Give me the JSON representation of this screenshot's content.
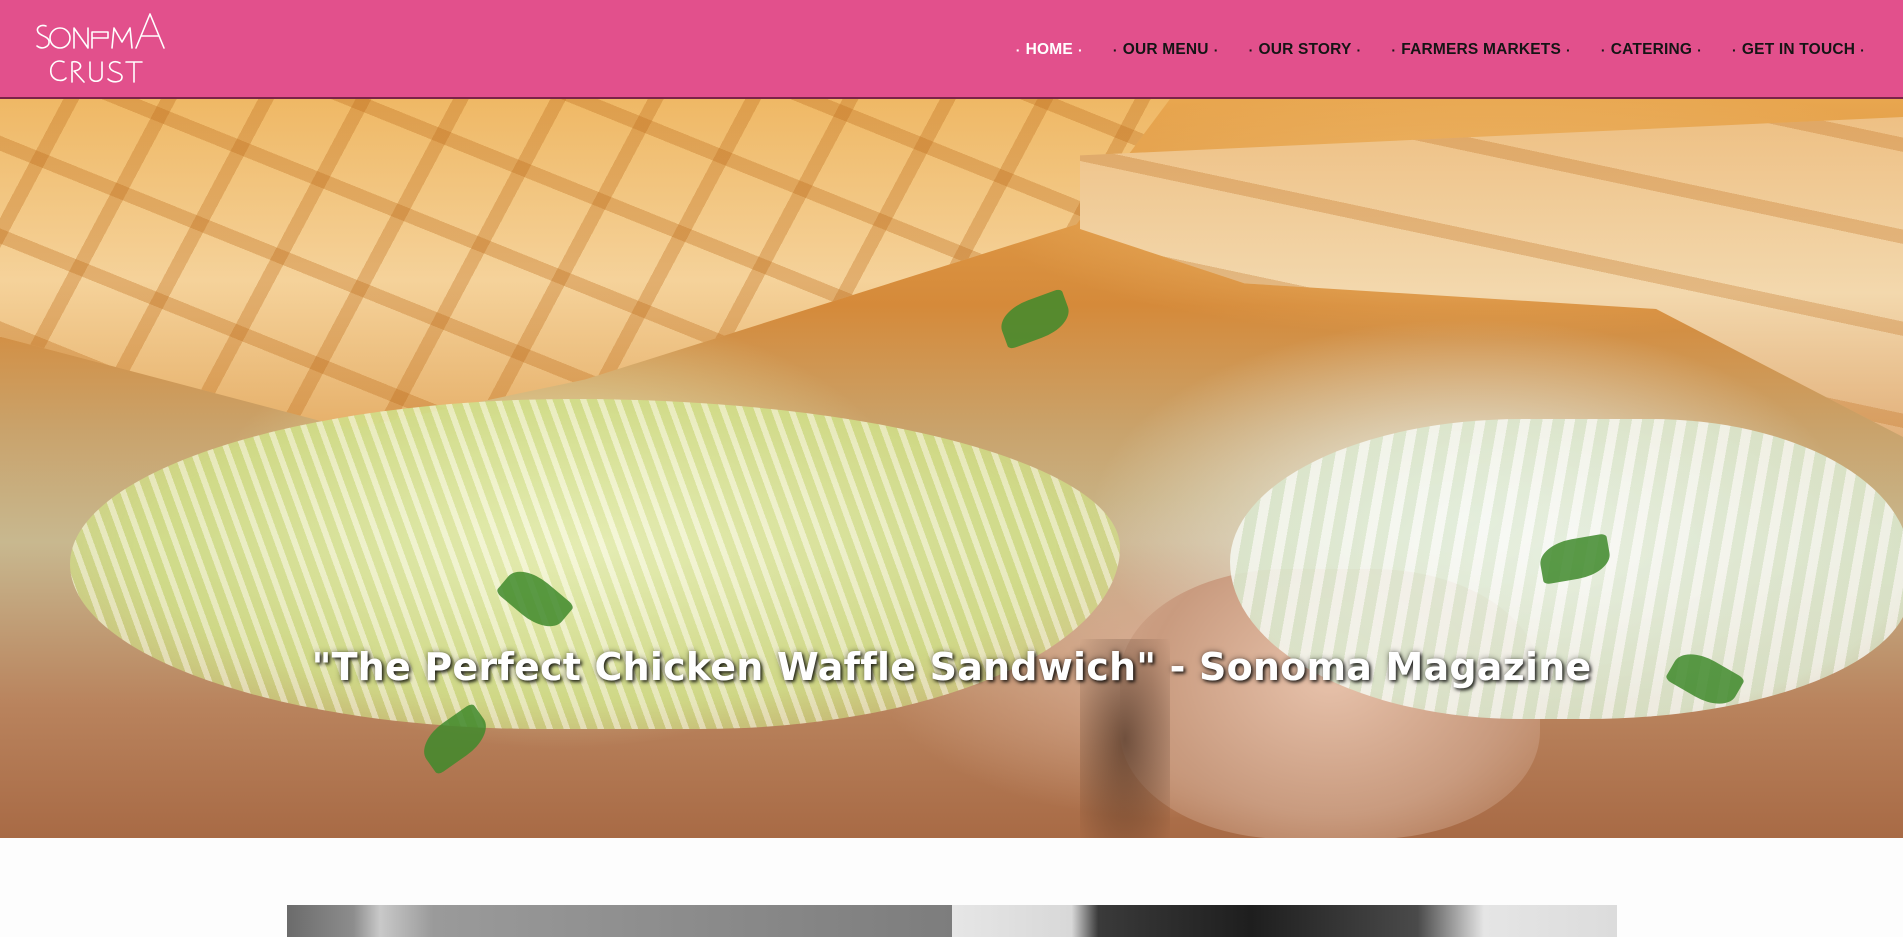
{
  "brand": {
    "logo_text_line1": "SONOMA",
    "logo_text_line2": "CRUST",
    "header_color": "#e2508c"
  },
  "nav": {
    "items": [
      {
        "label": "HOME",
        "active": true
      },
      {
        "label": "OUR MENU",
        "active": false
      },
      {
        "label": "OUR STORY",
        "active": false
      },
      {
        "label": "FARMERS MARKETS",
        "active": false
      },
      {
        "label": "CATERING",
        "active": false
      },
      {
        "label": "GET IN TOUCH",
        "active": false
      }
    ],
    "separator": "·"
  },
  "hero": {
    "image_subject": "chicken waffle sandwich with coleslaw",
    "caption": "\"The Perfect Chicken Waffle Sandwich\" - Sonoma Magazine"
  },
  "gallery": {
    "left_photo_subject": "black and white food photo",
    "right_photo_subject": "black and white portrait photo"
  }
}
